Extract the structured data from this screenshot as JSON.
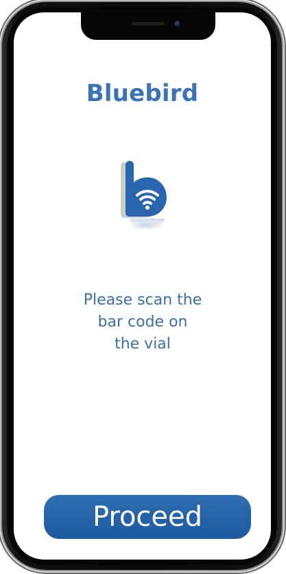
{
  "app": {
    "title": "Bluebird"
  },
  "logo": {
    "icon": "bird-wifi-logo-icon",
    "color": "#2a66ad"
  },
  "main": {
    "prompt_line_1": "Please scan the",
    "prompt_line_2": "bar code on",
    "prompt_line_3": "the vial"
  },
  "actions": {
    "proceed_label": "Proceed"
  },
  "colors": {
    "accent": "#3c73b5",
    "button": "#2563a8",
    "button_text": "#ffffff",
    "background": "#ffffff"
  }
}
